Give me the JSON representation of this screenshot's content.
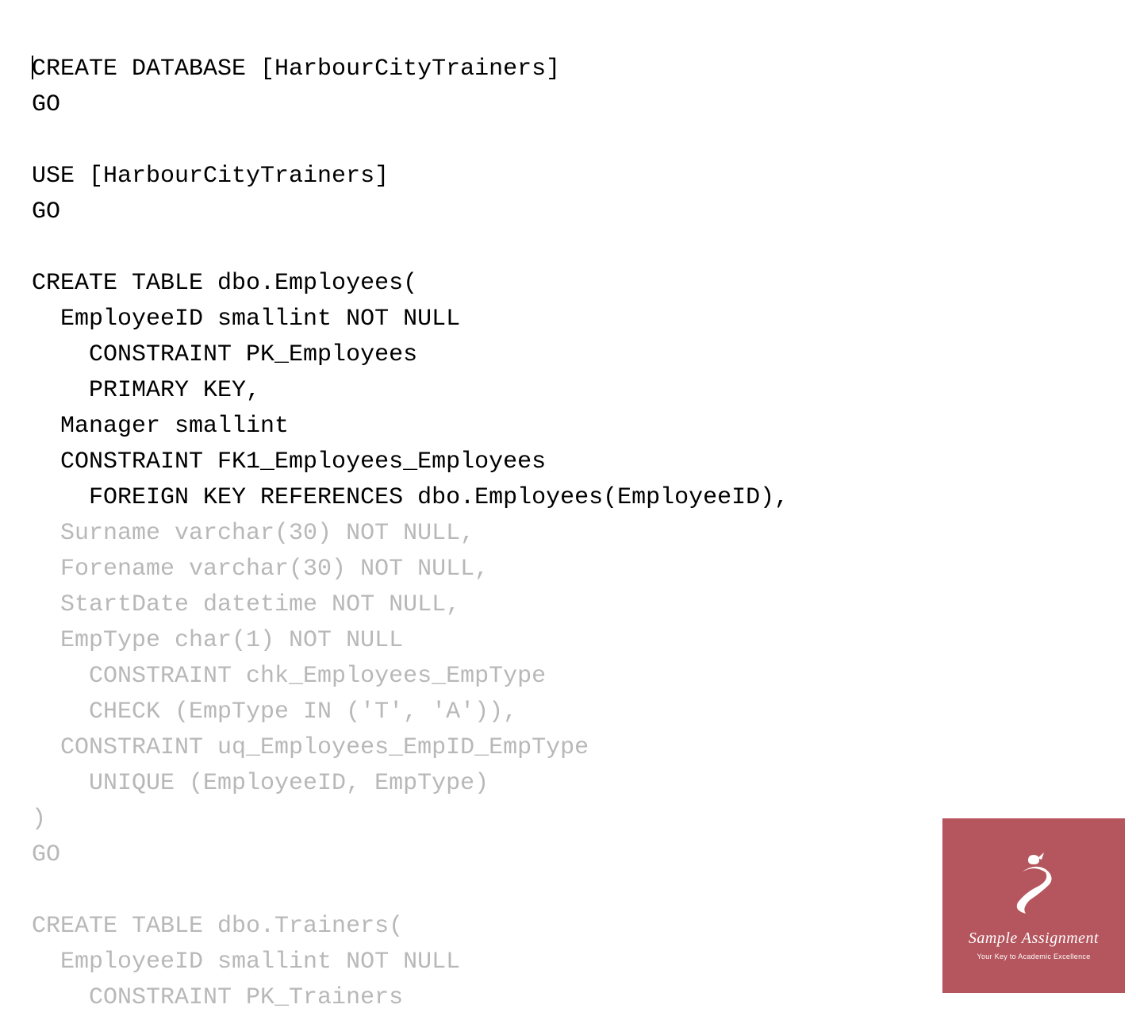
{
  "code": {
    "line1": "CREATE DATABASE [HarbourCityTrainers]",
    "line2": "GO",
    "line3": "",
    "line4": "USE [HarbourCityTrainers]",
    "line5": "GO",
    "line6": "",
    "line7": "CREATE TABLE dbo.Employees(",
    "line8": "  EmployeeID smallint NOT NULL",
    "line9": "    CONSTRAINT PK_Employees",
    "line10": "    PRIMARY KEY,",
    "line11": "  Manager smallint",
    "line12": "  CONSTRAINT FK1_Employees_Employees",
    "line13": "    FOREIGN KEY REFERENCES dbo.Employees(EmployeeID),",
    "line14": "  Surname varchar(30) NOT NULL,",
    "line15": "  Forename varchar(30) NOT NULL,",
    "line16": "  StartDate datetime NOT NULL,",
    "line17": "  EmpType char(1) NOT NULL",
    "line18": "    CONSTRAINT chk_Employees_EmpType",
    "line19": "    CHECK (EmpType IN ('T', 'A')),",
    "line20": "  CONSTRAINT uq_Employees_EmpID_EmpType",
    "line21": "    UNIQUE (EmployeeID, EmpType)",
    "line22": ")",
    "line23": "GO",
    "line24": "",
    "line25": "CREATE TABLE dbo.Trainers(",
    "line26": "  EmployeeID smallint NOT NULL",
    "line27": "    CONSTRAINT PK_Trainers"
  },
  "watermark": {
    "brand": "Sample Assignment",
    "tagline": "Your Key to Academic Excellence"
  }
}
